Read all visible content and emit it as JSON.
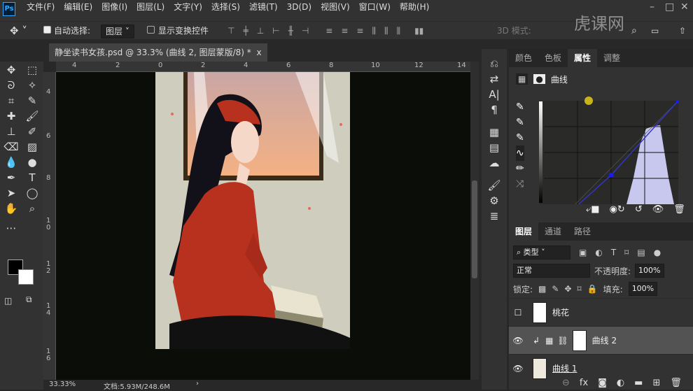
{
  "app": {
    "logo": "Ps",
    "menu": [
      "文件(F)",
      "编辑(E)",
      "图像(I)",
      "图层(L)",
      "文字(Y)",
      "选择(S)",
      "滤镜(T)",
      "3D(D)",
      "视图(V)",
      "窗口(W)",
      "帮助(H)"
    ],
    "window_controls": [
      "–",
      "□",
      "✕"
    ]
  },
  "options": {
    "auto_select_label": "自动选择:",
    "auto_select_checked": true,
    "auto_select_target": "图层",
    "show_transform_label": "显示变换控件",
    "show_transform_checked": false,
    "mode_3d_label": "3D 模式:"
  },
  "watermark": "虎课网",
  "document": {
    "tab_title": "静坐读书女孩.psd @ 33.3% (曲线 2, 图层蒙版/8) *",
    "close": "x"
  },
  "rulers": {
    "horizontal": [
      "4",
      "2",
      "0",
      "2",
      "4",
      "6",
      "8",
      "10",
      "12",
      "14"
    ],
    "vertical": [
      "4",
      "6",
      "8",
      "1 0",
      "1 2",
      "1 4",
      "1 6"
    ]
  },
  "status": {
    "zoom": "33.33%",
    "doc_size": "文档:5.93M/248.6M"
  },
  "properties_panel": {
    "tabs": [
      "颜色",
      "色板",
      "属性",
      "调整"
    ],
    "active_tab": "属性",
    "title": "曲线",
    "curve_points": [
      [
        0,
        0
      ],
      [
        128,
        115
      ],
      [
        255,
        255
      ]
    ]
  },
  "layers_panel": {
    "tabs": [
      "图层",
      "通道",
      "路径"
    ],
    "active_tab": "图层",
    "filter_label": "类型",
    "blend_mode": "正常",
    "opacity_label": "不透明度:",
    "opacity": "100%",
    "lock_label": "锁定:",
    "fill_label": "填充:",
    "fill": "100%",
    "layers": [
      {
        "name": "桃花",
        "visible": false
      },
      {
        "name": "曲线 2",
        "visible": true,
        "selected": true
      },
      {
        "name": "曲线 1",
        "visible": true
      }
    ]
  },
  "colors": {
    "accent": "#3333cc",
    "histogram": "#c8c8ee",
    "dress": "#b8301e",
    "background": "#cfcdbd"
  }
}
